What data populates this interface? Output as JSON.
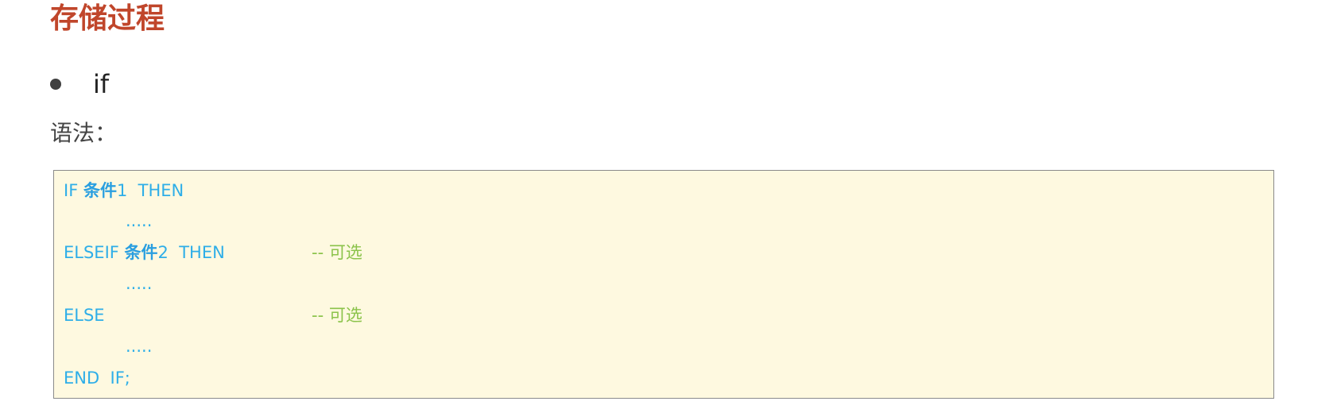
{
  "title": "存储过程",
  "bullet": {
    "text": "if"
  },
  "syntax_label": "语法：",
  "code": {
    "line1": {
      "kw1": "IF ",
      "cond": "条件",
      "rest": "1  THEN"
    },
    "line2": {
      "text": "....."
    },
    "line3": {
      "kw1": "ELSEIF ",
      "cond": "条件",
      "rest": "2  THEN",
      "comment": "-- 可选"
    },
    "line4": {
      "text": "....."
    },
    "line5": {
      "kw1": "ELSE",
      "comment": "-- 可选"
    },
    "line6": {
      "text": "....."
    },
    "line7": {
      "text": "END  IF;"
    }
  },
  "colors": {
    "title": "#c0462b",
    "code_text": "#2eaee8",
    "comment": "#8bc34a",
    "code_bg": "#fef9e0"
  }
}
